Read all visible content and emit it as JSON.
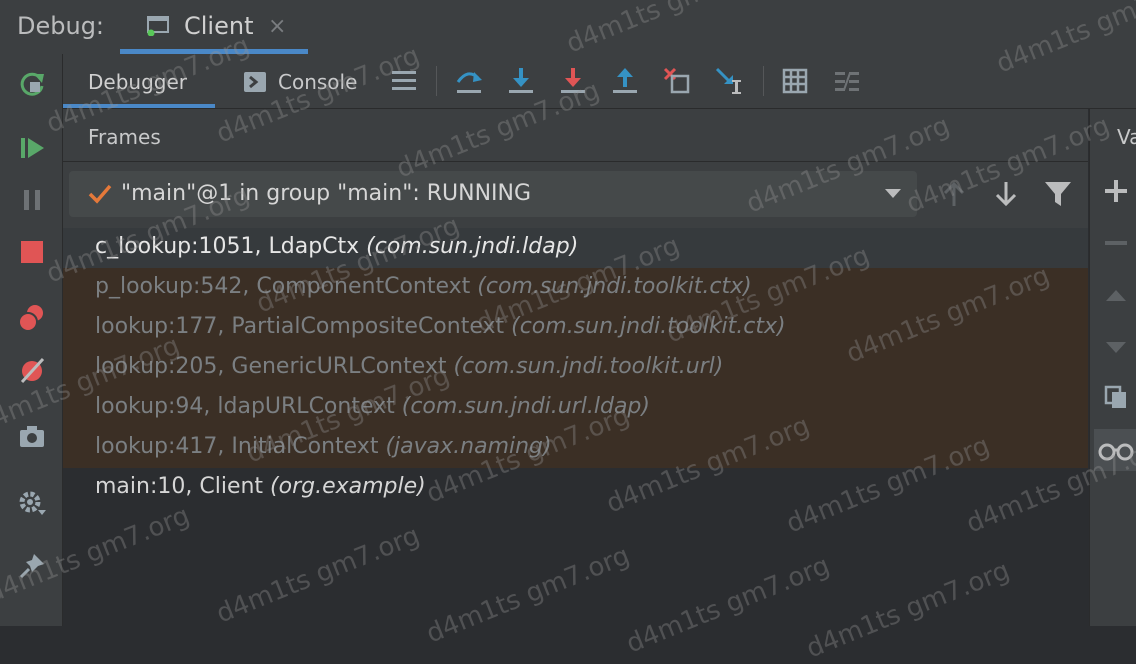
{
  "top": {
    "debug_label": "Debug:",
    "tab_label": "Client",
    "tab_close": "×"
  },
  "subtabs": {
    "debugger": "Debugger",
    "console": "Console"
  },
  "frames": {
    "title": "Frames",
    "thread": "\"main\"@1 in group \"main\": RUNNING",
    "rows": [
      {
        "name": "c_lookup:1051, LdapCtx ",
        "pkg": "(com.sun.jndi.ldap)"
      },
      {
        "name": "p_lookup:542, ComponentContext ",
        "pkg": "(com.sun.jndi.toolkit.ctx)"
      },
      {
        "name": "lookup:177, PartialCompositeContext ",
        "pkg": "(com.sun.jndi.toolkit.ctx)"
      },
      {
        "name": "lookup:205, GenericURLContext ",
        "pkg": "(com.sun.jndi.toolkit.url)"
      },
      {
        "name": "lookup:94, ldapURLContext ",
        "pkg": "(com.sun.jndi.url.ldap)"
      },
      {
        "name": "lookup:417, InitialContext ",
        "pkg": "(javax.naming)"
      },
      {
        "name": "main:10, Client ",
        "pkg": "(org.example)"
      }
    ]
  },
  "right": {
    "title": "Va"
  },
  "watermark": "d4m1ts gm7.org",
  "colors": {
    "accent": "#4a88c7",
    "resume": "#59a869",
    "stop": "#e05555",
    "lib_row": "#3b2f25"
  }
}
